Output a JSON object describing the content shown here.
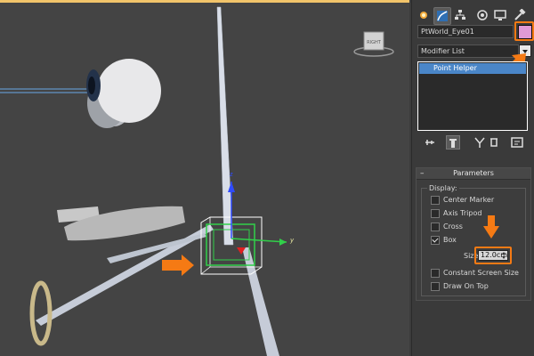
{
  "viewport": {
    "viewcube_label": "RIGHT",
    "gizmo_axis_y": "y",
    "gizmo_axis_z": "z"
  },
  "panel": {
    "tabs": [
      {
        "icon": "create-star-icon",
        "active": false
      },
      {
        "icon": "modify-curve-icon",
        "active": true
      },
      {
        "icon": "hierarchy-icon",
        "active": false
      },
      {
        "icon": "motion-icon",
        "active": false
      },
      {
        "icon": "display-monitor-icon",
        "active": false
      },
      {
        "icon": "utilities-hammer-icon",
        "active": false
      }
    ],
    "object_name": "PtWorld_Eye01",
    "object_color": "#e19ad6",
    "modifier_list_label": "Modifier List",
    "stack_items": [
      "Point Helper"
    ],
    "parameters": {
      "title": "Parameters",
      "collapse_symbol": "–",
      "display_group": "Display:",
      "options": [
        {
          "label": "Center Marker",
          "checked": false
        },
        {
          "label": "Axis Tripod",
          "checked": false
        },
        {
          "label": "Cross",
          "checked": false
        },
        {
          "label": "Box",
          "checked": true
        }
      ],
      "size_label": "Size:",
      "size_value": "12.0cm",
      "options2": [
        {
          "label": "Constant Screen Size",
          "checked": false
        },
        {
          "label": "Draw On Top",
          "checked": false
        }
      ]
    }
  },
  "colors": {
    "highlight": "#f57a14",
    "selection": "#4a86c8",
    "viewport_bg": "#444444",
    "panel_bg": "#3a3a3a"
  }
}
